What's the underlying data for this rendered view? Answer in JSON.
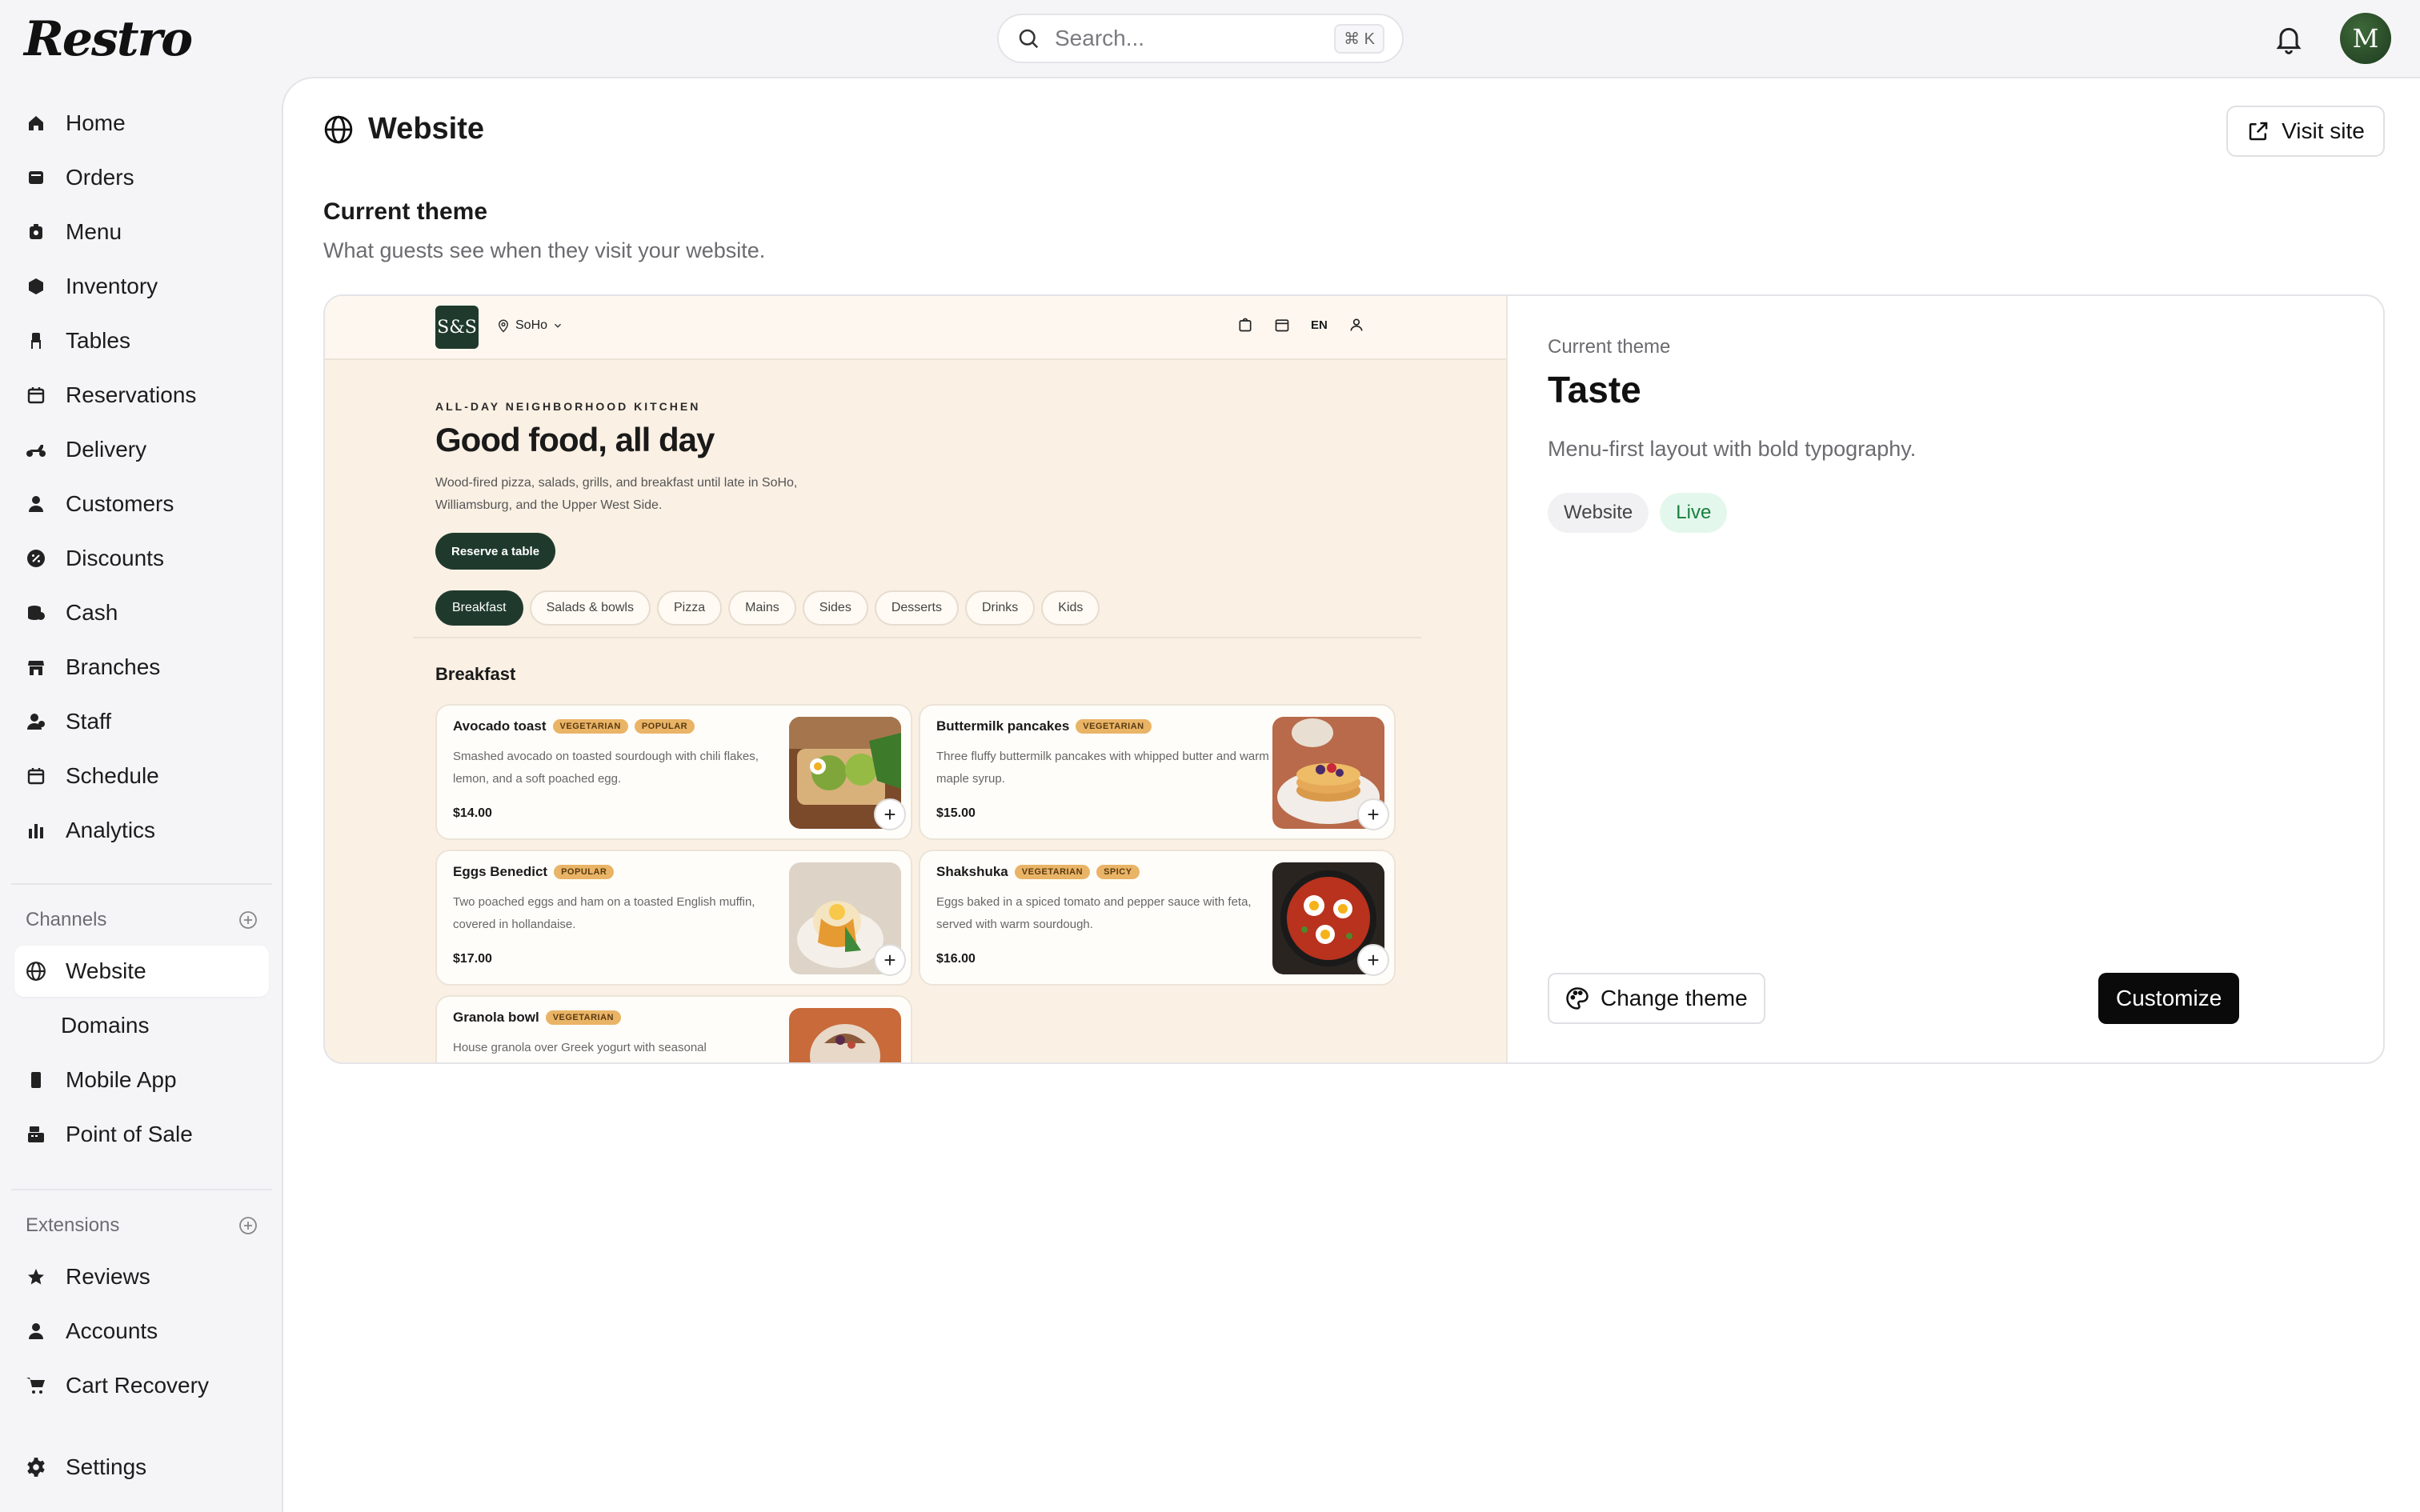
{
  "app": {
    "logo": "Restro"
  },
  "search": {
    "placeholder": "Search...",
    "shortcut": "⌘ K"
  },
  "user": {
    "avatar_initial": "M"
  },
  "sidebar": {
    "items": [
      {
        "label": "Home",
        "icon": "home-icon"
      },
      {
        "label": "Orders",
        "icon": "orders-icon"
      },
      {
        "label": "Menu",
        "icon": "menu-icon"
      },
      {
        "label": "Inventory",
        "icon": "inventory-icon"
      },
      {
        "label": "Tables",
        "icon": "tables-icon"
      },
      {
        "label": "Reservations",
        "icon": "calendar-icon"
      },
      {
        "label": "Delivery",
        "icon": "scooter-icon"
      },
      {
        "label": "Customers",
        "icon": "person-icon"
      },
      {
        "label": "Discounts",
        "icon": "discount-icon"
      },
      {
        "label": "Cash",
        "icon": "cash-icon"
      },
      {
        "label": "Branches",
        "icon": "store-icon"
      },
      {
        "label": "Staff",
        "icon": "staff-icon"
      },
      {
        "label": "Schedule",
        "icon": "calendar-icon"
      },
      {
        "label": "Analytics",
        "icon": "chart-icon"
      }
    ],
    "channels_header": "Channels",
    "channels": [
      {
        "label": "Website",
        "icon": "globe-icon",
        "active": true
      },
      {
        "label": "Domains",
        "icon": "",
        "sub": true
      },
      {
        "label": "Mobile App",
        "icon": "phone-icon"
      },
      {
        "label": "Point of Sale",
        "icon": "pos-icon"
      }
    ],
    "extensions_header": "Extensions",
    "extensions": [
      {
        "label": "Reviews",
        "icon": "star-icon"
      },
      {
        "label": "Accounts",
        "icon": "person-icon"
      },
      {
        "label": "Cart Recovery",
        "icon": "cart-icon"
      }
    ],
    "settings": {
      "label": "Settings",
      "icon": "gear-icon"
    }
  },
  "page": {
    "title": "Website",
    "visit_label": "Visit site",
    "section_title": "Current theme",
    "section_sub": "What guests see when they visit your website."
  },
  "preview": {
    "logo": "S&S",
    "location": "SoHo",
    "lang": "EN",
    "eyebrow": "ALL-DAY NEIGHBORHOOD KITCHEN",
    "hero": "Good food, all day",
    "desc": "Wood-fired pizza, salads, grills, and breakfast until late in SoHo, Williamsburg, and the Upper West Side.",
    "reserve": "Reserve a table",
    "chips": [
      "Breakfast",
      "Salads & bowls",
      "Pizza",
      "Mains",
      "Sides",
      "Desserts",
      "Drinks",
      "Kids"
    ],
    "category": "Breakfast",
    "items": [
      {
        "name": "Avocado toast",
        "tags": [
          "VEGETARIAN",
          "POPULAR"
        ],
        "desc": "Smashed avocado on toasted sourdough with chili flakes, lemon, and a soft poached egg.",
        "price": "$14.00"
      },
      {
        "name": "Buttermilk pancakes",
        "tags": [
          "VEGETARIAN"
        ],
        "desc": "Three fluffy buttermilk pancakes with whipped butter and warm maple syrup.",
        "price": "$15.00"
      },
      {
        "name": "Eggs Benedict",
        "tags": [
          "POPULAR"
        ],
        "desc": "Two poached eggs and ham on a toasted English muffin, covered in hollandaise.",
        "price": "$17.00"
      },
      {
        "name": "Shakshuka",
        "tags": [
          "VEGETARIAN",
          "SPICY"
        ],
        "desc": "Eggs baked in a spiced tomato and pepper sauce with feta, served with warm sourdough.",
        "price": "$16.00"
      },
      {
        "name": "Granola bowl",
        "tags": [
          "VEGETARIAN"
        ],
        "desc": "House granola over Greek yogurt with seasonal",
        "price": ""
      }
    ]
  },
  "theme": {
    "label": "Current theme",
    "name": "Taste",
    "desc": "Menu-first layout with bold typography.",
    "badges": [
      "Website",
      "Live"
    ],
    "change_label": "Change theme",
    "customize_label": "Customize"
  },
  "colors": {
    "accent": "#1f3a2c",
    "live": "#17803d",
    "preview_bg": "#faf0e4",
    "tag": "#e9b466"
  }
}
